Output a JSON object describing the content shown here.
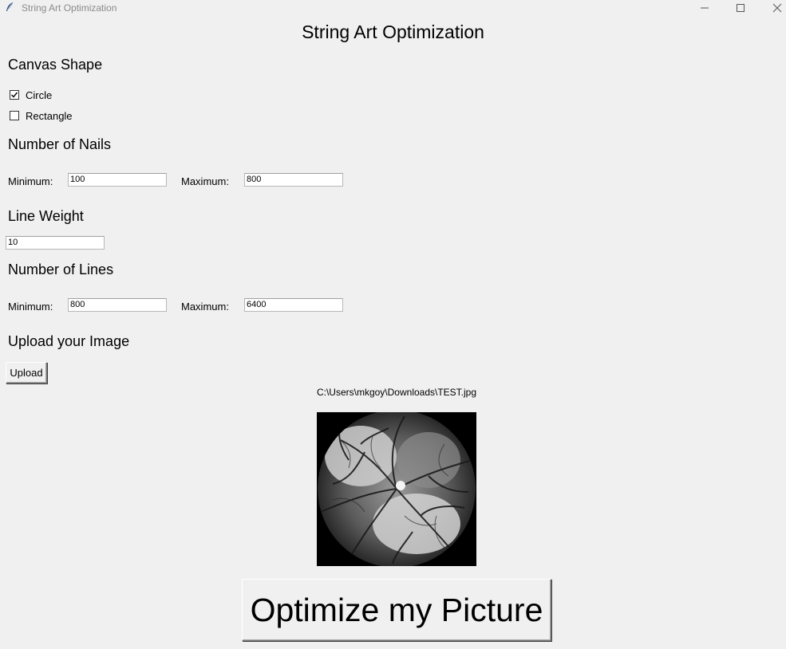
{
  "window": {
    "title": "String Art Optimization",
    "controls": {
      "minimize": "minimize-icon",
      "maximize": "maximize-icon",
      "close": "close-icon"
    }
  },
  "main_title": "String Art Optimization",
  "canvas_shape": {
    "title": "Canvas Shape",
    "options": [
      {
        "label": "Circle",
        "checked": true
      },
      {
        "label": "Rectangle",
        "checked": false
      }
    ]
  },
  "nails": {
    "title": "Number of Nails",
    "min_label": "Minimum:",
    "min_value": "100",
    "max_label": "Maximum:",
    "max_value": "800"
  },
  "line_weight": {
    "title": "Line Weight",
    "value": "10"
  },
  "lines": {
    "title": "Number of Lines",
    "min_label": "Minimum:",
    "min_value": "800",
    "max_label": "Maximum:",
    "max_value": "6400"
  },
  "upload": {
    "title": "Upload your Image",
    "button_label": "Upload",
    "file_path": "C:\\Users\\mkgoy\\Downloads\\TEST.jpg",
    "preview_icon": "image-preview"
  },
  "optimize_button": "Optimize my Picture"
}
